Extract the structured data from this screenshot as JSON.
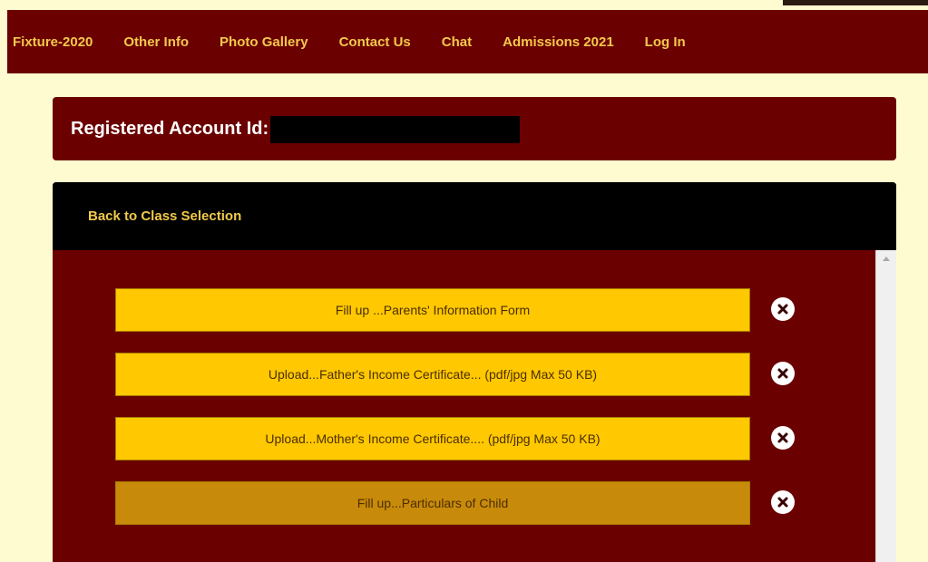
{
  "nav": {
    "items": [
      "Fixture-2020",
      "Other Info",
      "Photo Gallery",
      "Contact Us",
      "Chat",
      "Admissions 2021",
      "Log In"
    ]
  },
  "account": {
    "label": "Registered Account Id:"
  },
  "panel": {
    "back_link": "Back to Class Selection"
  },
  "actions": [
    {
      "label": "Fill up ...Parents' Information Form",
      "state": "pending"
    },
    {
      "label": "Upload...Father's Income Certificate... (pdf/jpg Max 50 KB)",
      "state": "pending"
    },
    {
      "label": "Upload...Mother's Income Certificate.... (pdf/jpg Max 50 KB)",
      "state": "pending"
    },
    {
      "label": "Fill up...Particulars of Child",
      "state": "done"
    }
  ],
  "colors": {
    "maroon": "#6b0000",
    "gold": "#ffc800",
    "gold_dark": "#c88a0a",
    "cream": "#fefbd0"
  },
  "icons": {
    "remove": "close-icon"
  }
}
